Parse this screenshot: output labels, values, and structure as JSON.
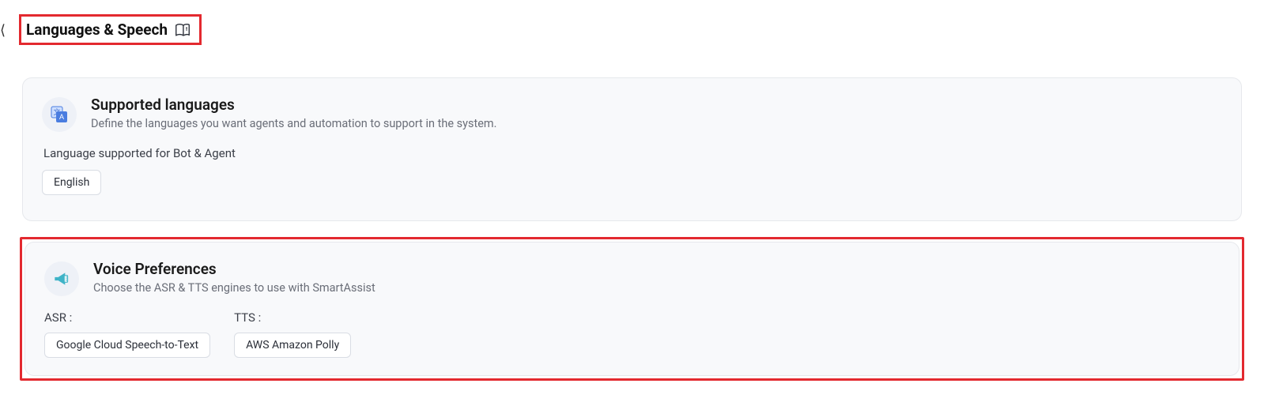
{
  "header": {
    "title": "Languages & Speech"
  },
  "supported": {
    "title": "Supported languages",
    "description": "Define the languages you want agents and automation to support in the system.",
    "subheading": "Language supported for Bot & Agent",
    "chip": "English"
  },
  "voice": {
    "title": "Voice Preferences",
    "description": "Choose the ASR & TTS engines to use with SmartAssist",
    "asr": {
      "label": "ASR :",
      "value": "Google Cloud Speech-to-Text"
    },
    "tts": {
      "label": "TTS :",
      "value": "AWS Amazon Polly"
    }
  }
}
